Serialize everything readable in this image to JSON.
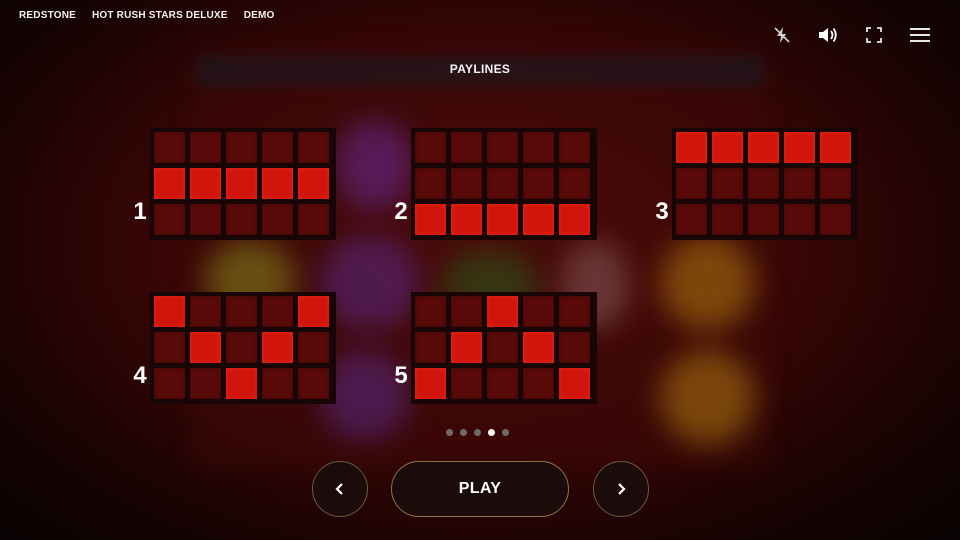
{
  "brand": {
    "studio": "REDSTONE",
    "game": "HOT RUSH STARS DELUXE",
    "mode": "DEMO"
  },
  "top_icons": [
    "flash-off-icon",
    "volume-icon",
    "fullscreen-icon",
    "menu-icon"
  ],
  "title": "PAYLINES",
  "paylines": [
    {
      "number": "1",
      "rows": [
        [
          0,
          0,
          0,
          0,
          0
        ],
        [
          1,
          1,
          1,
          1,
          1
        ],
        [
          0,
          0,
          0,
          0,
          0
        ]
      ]
    },
    {
      "number": "2",
      "rows": [
        [
          0,
          0,
          0,
          0,
          0
        ],
        [
          0,
          0,
          0,
          0,
          0
        ],
        [
          1,
          1,
          1,
          1,
          1
        ]
      ]
    },
    {
      "number": "3",
      "rows": [
        [
          1,
          1,
          1,
          1,
          1
        ],
        [
          0,
          0,
          0,
          0,
          0
        ],
        [
          0,
          0,
          0,
          0,
          0
        ]
      ]
    },
    {
      "number": "4",
      "rows": [
        [
          1,
          0,
          0,
          0,
          1
        ],
        [
          0,
          1,
          0,
          1,
          0
        ],
        [
          0,
          0,
          1,
          0,
          0
        ]
      ]
    },
    {
      "number": "5",
      "rows": [
        [
          0,
          0,
          1,
          0,
          0
        ],
        [
          0,
          1,
          0,
          1,
          0
        ],
        [
          1,
          0,
          0,
          0,
          1
        ]
      ]
    }
  ],
  "pager": {
    "total": 5,
    "current": 4
  },
  "buttons": {
    "prev": "‹",
    "play": "PLAY",
    "next": "›"
  },
  "colors": {
    "active_cell": "#d1140c",
    "inactive_cell": "#5a0b09",
    "button_border": "#8f7344"
  }
}
